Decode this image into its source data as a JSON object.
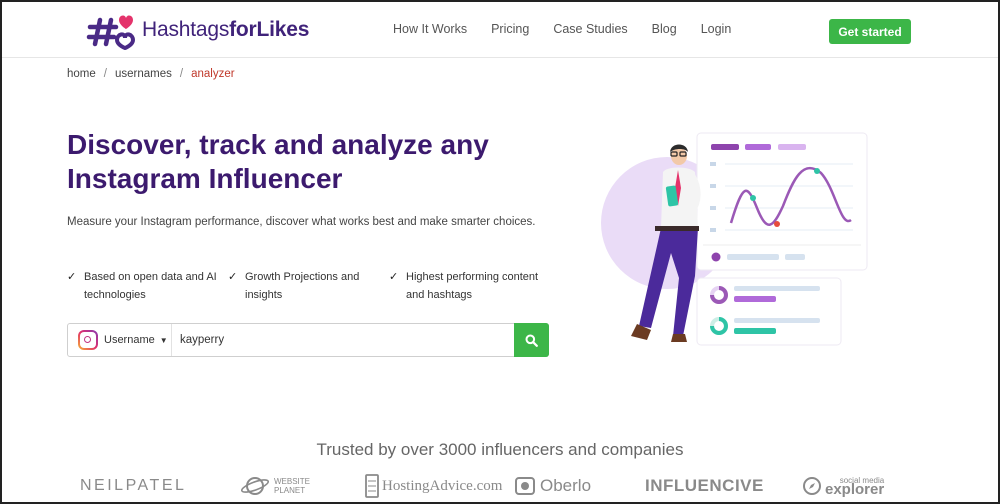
{
  "header": {
    "logo": {
      "part1": "Hashtags",
      "part2": "forLikes"
    },
    "nav": [
      {
        "label": "How It Works"
      },
      {
        "label": "Pricing"
      },
      {
        "label": "Case Studies"
      },
      {
        "label": "Blog"
      },
      {
        "label": "Login"
      }
    ],
    "cta_label": "Get started"
  },
  "breadcrumb": {
    "items": [
      "home",
      "usernames",
      "analyzer"
    ],
    "separator": "/"
  },
  "hero": {
    "title_line1": "Discover, track and analyze any",
    "title_line2": "Instagram Influencer",
    "subtitle": "Measure your Instagram performance, discover what works best and make smarter choices.",
    "features": [
      {
        "icon": "check-icon",
        "line1": "Based on open data and AI",
        "line2": "technologies"
      },
      {
        "icon": "check-icon",
        "line1": "Growth Projections and",
        "line2": "insights"
      },
      {
        "icon": "check-icon",
        "line1": "Highest performing content",
        "line2": "and hashtags"
      }
    ]
  },
  "search": {
    "dropdown_label": "Username",
    "dropdown_icon": "instagram-icon",
    "input_value": "kayperry",
    "button_icon": "search-icon"
  },
  "trusted": {
    "heading": "Trusted by over 3000 influencers and companies",
    "brands": [
      {
        "name": "NEILPATEL"
      },
      {
        "line1": "WEBSITE",
        "line2": "PLANET"
      },
      {
        "name": "HostingAdvice.com"
      },
      {
        "name": "Oberlo"
      },
      {
        "name": "INFLUENCIVE"
      },
      {
        "line1": "social media",
        "line2": "explorer"
      }
    ]
  },
  "colors": {
    "brand_purple": "#3c1a6e",
    "accent_green": "#3cb648",
    "breadcrumb_active": "#c0392b",
    "illustration_purple": "#9b59b6",
    "illustration_teal": "#2ec4a6"
  }
}
